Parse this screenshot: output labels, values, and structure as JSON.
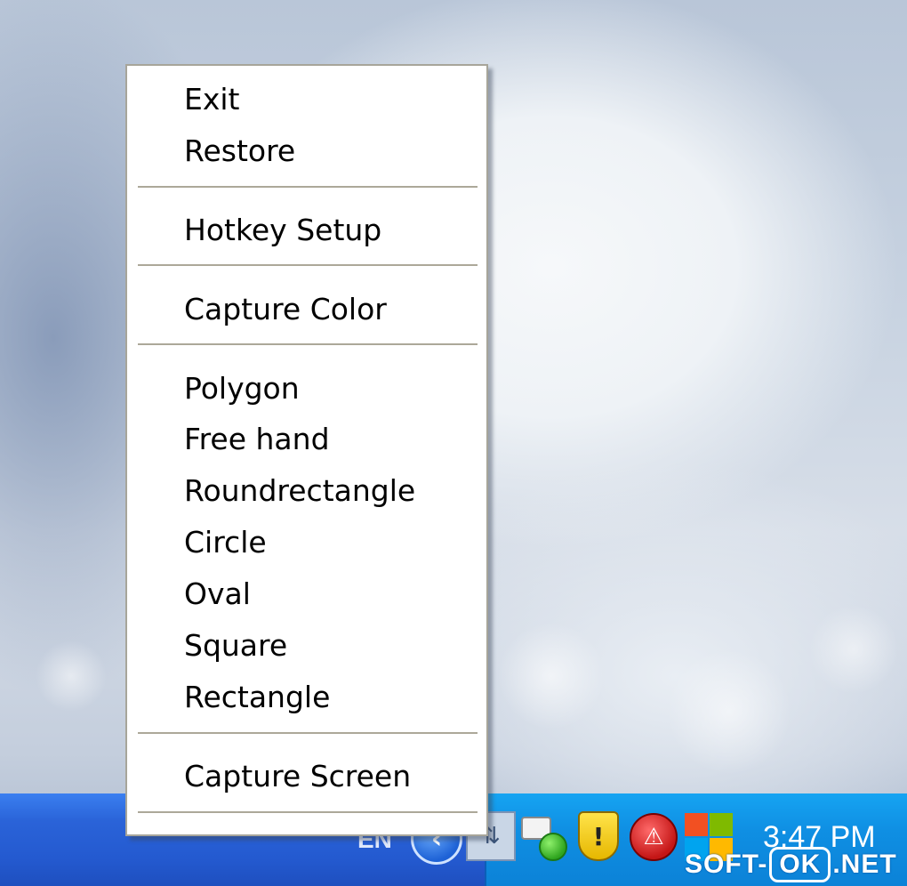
{
  "menu": {
    "items": [
      {
        "label": "Exit"
      },
      {
        "label": "Restore"
      },
      {
        "label": "Hotkey Setup"
      },
      {
        "label": "Capture Color"
      },
      {
        "label": "Polygon"
      },
      {
        "label": "Free hand"
      },
      {
        "label": "Roundrectangle"
      },
      {
        "label": "Circle"
      },
      {
        "label": "Oval"
      },
      {
        "label": "Square"
      },
      {
        "label": "Rectangle"
      },
      {
        "label": "Capture Screen"
      }
    ]
  },
  "taskbar": {
    "language": "EN",
    "clock": "3:47 PM",
    "tray_icons": [
      "back-arrow-icon",
      "network-icon",
      "messenger-icon",
      "security-shield-icon",
      "alert-icon",
      "windows-update-icon"
    ]
  },
  "watermark": {
    "prefix": "SOFT-",
    "boxed": "OK",
    "suffix": ".NET"
  },
  "colors": {
    "taskbar_blue": "#245ad0",
    "tray_blue": "#0f8fe3",
    "menu_bg": "#ffffff",
    "separator": "#aca899"
  }
}
